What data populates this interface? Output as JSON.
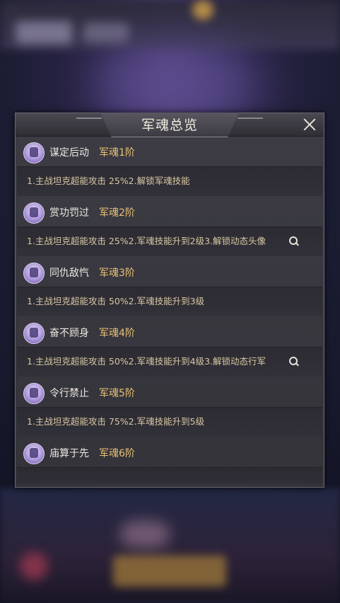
{
  "dialog": {
    "title": "军魂总览",
    "entries": [
      {
        "name": "谋定后动",
        "rank": "军魂1阶",
        "desc": "1.主战坦克超能攻击 25%2.解锁军魂技能",
        "has_preview": false
      },
      {
        "name": "赏功罚过",
        "rank": "军魂2阶",
        "desc": "1.主战坦克超能攻击 25%2.军魂技能升到2级3.解锁动态头像",
        "has_preview": true
      },
      {
        "name": "同仇敌忾",
        "rank": "军魂3阶",
        "desc": "1.主战坦克超能攻击 50%2.军魂技能升到3级",
        "has_preview": false
      },
      {
        "name": "奋不顾身",
        "rank": "军魂4阶",
        "desc": "1.主战坦克超能攻击 50%2.军魂技能升到4级3.解锁动态行军",
        "has_preview": true
      },
      {
        "name": "令行禁止",
        "rank": "军魂5阶",
        "desc": "1.主战坦克超能攻击 75%2.军魂技能升到5级",
        "has_preview": false
      },
      {
        "name": "庙算于先",
        "rank": "军魂6阶",
        "desc": "",
        "has_preview": false
      }
    ]
  },
  "icons": {
    "close": "close-icon",
    "entry": "soldier-badge-icon",
    "preview": "magnifier-icon"
  },
  "colors": {
    "rank": "#e8c173",
    "desc": "#d8c7a4",
    "title": "#f1ecdf"
  }
}
